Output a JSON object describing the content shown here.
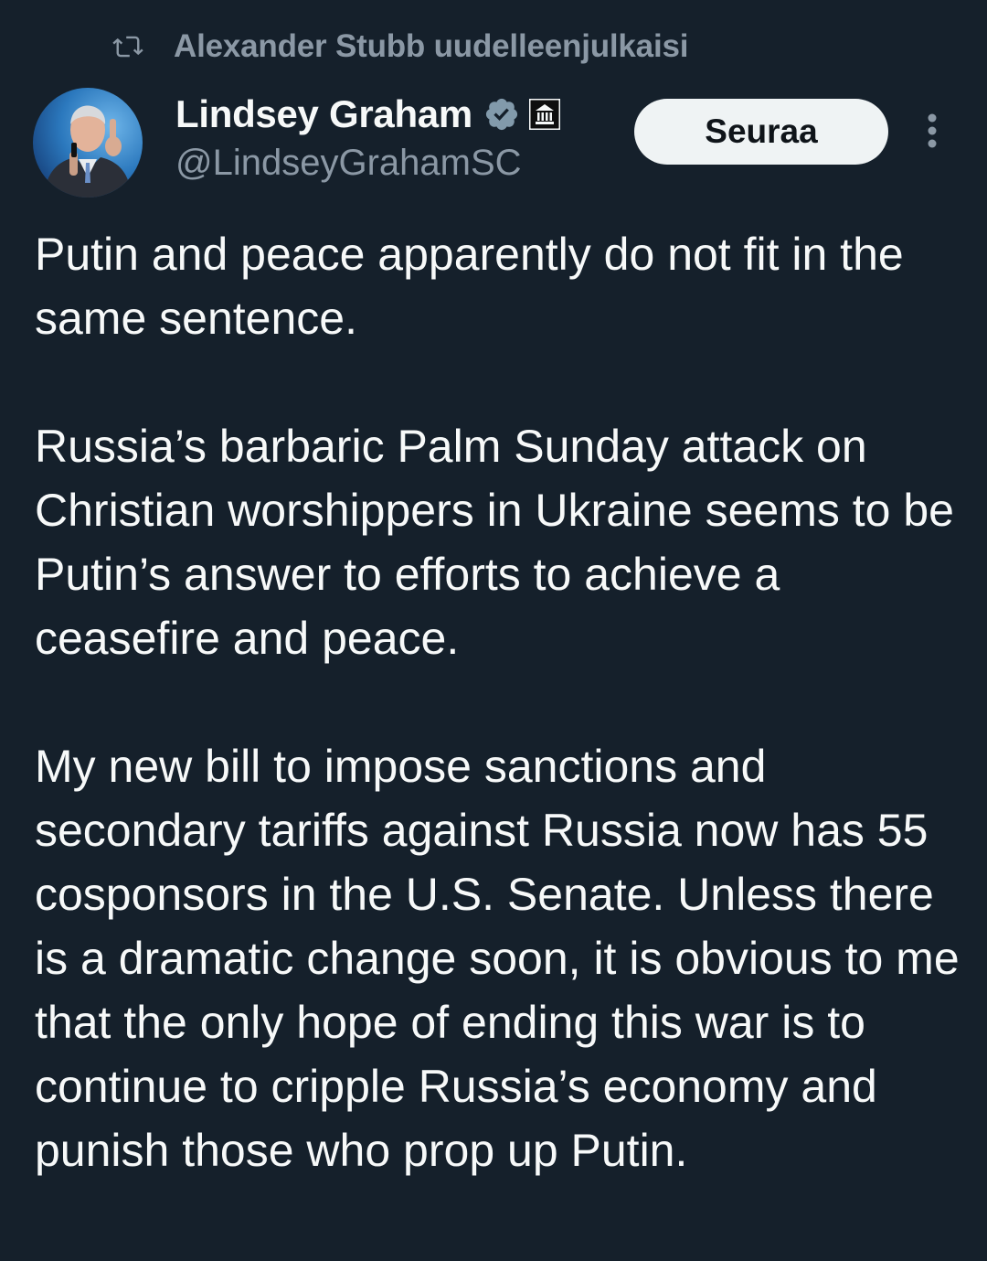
{
  "repost": {
    "icon": "repost-icon",
    "text": "Alexander Stubb uudelleenjulkaisi"
  },
  "author": {
    "name": "Lindsey Graham",
    "handle": "@LindseyGrahamSC",
    "verified_icon": "verified-badge-icon",
    "gov_badge_icon": "government-building-icon"
  },
  "actions": {
    "follow_label": "Seuraa",
    "more_icon": "more-vertical-icon"
  },
  "tweet": {
    "paragraphs": [
      "Putin and peace apparently do not fit in the same sentence.",
      "Russia’s barbaric Palm Sunday attack on Christian worshippers in Ukraine seems to be Putin’s answer to efforts to achieve a ceasefire and peace.",
      "My new bill to impose sanctions and secondary tariffs against Russia now has 55 cosponsors in the U.S. Senate. Unless there is a dramatic change soon, it is obvious to me that the only hope of ending this war is to continue to cripple Russia’s economy and punish those who prop up Putin."
    ]
  },
  "colors": {
    "background": "#15202b",
    "primary_text": "#f7f9f9",
    "secondary_text": "#8b98a5",
    "follow_button_bg": "#eff3f4",
    "verified_badge": "#829aab"
  }
}
